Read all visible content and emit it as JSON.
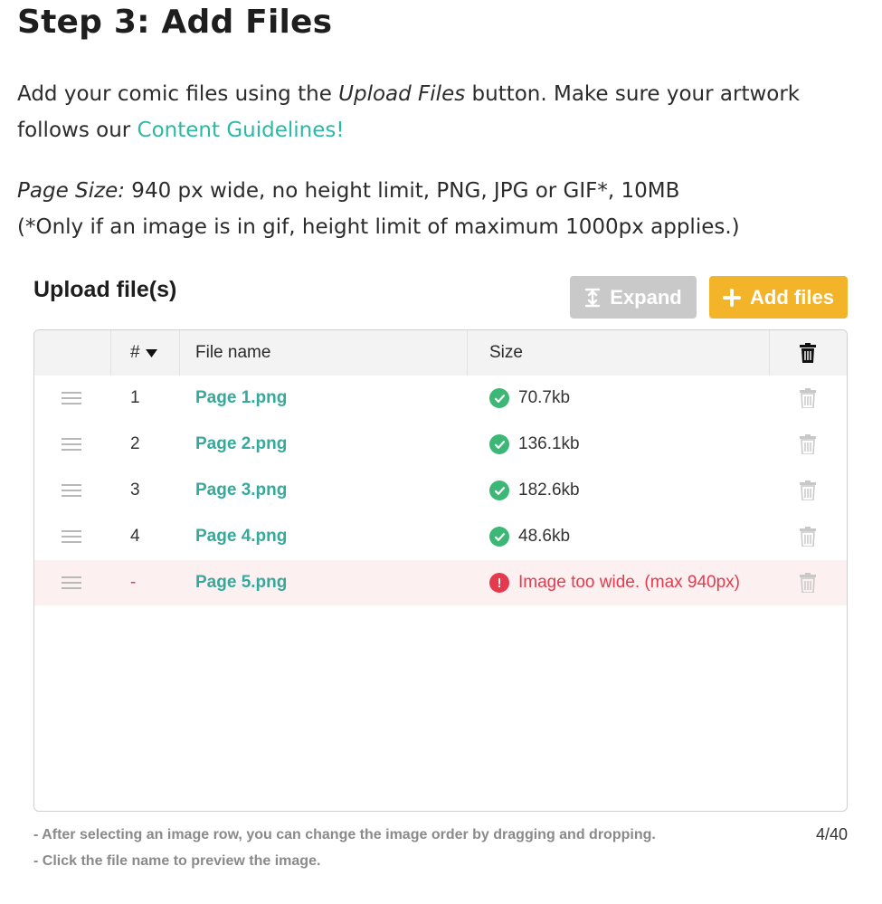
{
  "heading": "Step 3: Add Files",
  "intro": {
    "line1_pre": "Add your comic files using the ",
    "line1_em": "Upload Files",
    "line1_post": " button. Make sure your artwork",
    "line2_pre": "follows our ",
    "link": "Content Guidelines!"
  },
  "specs": {
    "label": "Page Size:",
    "text": " 940 px wide, no height limit, PNG, JPG or GIF*, 10MB",
    "note": "(*Only if an image is in gif, height limit of maximum 1000px applies.)"
  },
  "panel": {
    "title": "Upload file(s)",
    "expand_label": "Expand",
    "add_label": "Add files"
  },
  "table": {
    "col_num": "#",
    "col_name": "File name",
    "col_size": "Size",
    "rows": [
      {
        "num": "1",
        "name": "Page 1.png",
        "size": "70.7kb",
        "status": "ok"
      },
      {
        "num": "2",
        "name": "Page 2.png",
        "size": "136.1kb",
        "status": "ok"
      },
      {
        "num": "3",
        "name": "Page 3.png",
        "size": "182.6kb",
        "status": "ok"
      },
      {
        "num": "4",
        "name": "Page 4.png",
        "size": "48.6kb",
        "status": "ok"
      },
      {
        "num": "-",
        "name": "Page 5.png",
        "size": "Image too wide. (max 940px)",
        "status": "error"
      }
    ]
  },
  "footnotes": {
    "line1": "- After selecting an image row, you can change the image order by dragging and dropping.",
    "line2": "- Click the file name to preview the image.",
    "count": "4/40"
  },
  "colors": {
    "link": "#2bb8a6",
    "add_button": "#f4b42a",
    "expand_button": "#c9c9c9",
    "ok": "#3cb776",
    "error": "#e53a4d",
    "error_row_bg": "#fdf0f1"
  },
  "icons": {
    "expand": "expand-vertical-icon",
    "add": "plus-icon",
    "sort": "caret-down-icon",
    "delete": "trash-icon",
    "ok": "check-circle-icon",
    "error": "exclamation-circle-icon",
    "drag": "drag-handle-icon"
  }
}
